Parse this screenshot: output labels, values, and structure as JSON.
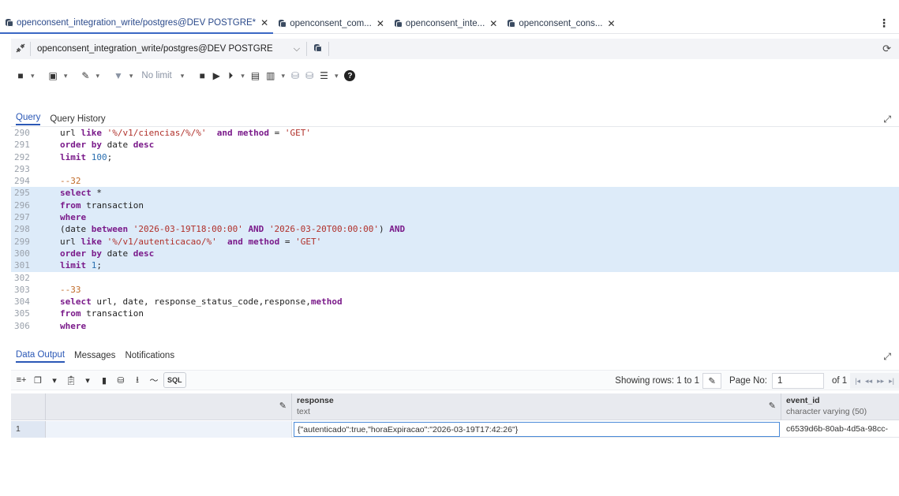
{
  "tabs": [
    {
      "label": "openconsent_integration_write/postgres@DEV POSTGRE*"
    },
    {
      "label": "openconsent_com..."
    },
    {
      "label": "openconsent_inte..."
    },
    {
      "label": "openconsent_cons..."
    }
  ],
  "connection": {
    "label": "openconsent_integration_write/postgres@DEV POSTGRE"
  },
  "toolbar": {
    "limit_label": "No limit"
  },
  "query_tabs": [
    "Query",
    "Query History"
  ],
  "editor_lines": [
    {
      "n": "290",
      "selected": false,
      "tokens": [
        [
          "",
          "url "
        ],
        [
          "kw",
          "like"
        ],
        [
          "",
          " "
        ],
        [
          "str",
          "'%/v1/ciencias/%/%'"
        ],
        [
          "",
          "  "
        ],
        [
          "kw",
          "and"
        ],
        [
          "",
          " "
        ],
        [
          "kw",
          "method"
        ],
        [
          "",
          " = "
        ],
        [
          "str",
          "'GET'"
        ]
      ]
    },
    {
      "n": "291",
      "selected": false,
      "tokens": [
        [
          "kw",
          "order by"
        ],
        [
          "",
          " date "
        ],
        [
          "kw",
          "desc"
        ]
      ]
    },
    {
      "n": "292",
      "selected": false,
      "tokens": [
        [
          "kw",
          "limit"
        ],
        [
          "",
          " "
        ],
        [
          "num",
          "100"
        ],
        [
          "",
          ";"
        ]
      ]
    },
    {
      "n": "293",
      "selected": false,
      "tokens": []
    },
    {
      "n": "294",
      "selected": false,
      "tokens": [
        [
          "cmt",
          "--32"
        ]
      ]
    },
    {
      "n": "295",
      "selected": true,
      "tokens": [
        [
          "kw",
          "select"
        ],
        [
          "",
          " *"
        ]
      ]
    },
    {
      "n": "296",
      "selected": true,
      "tokens": [
        [
          "kw",
          "from"
        ],
        [
          "",
          " transaction"
        ]
      ]
    },
    {
      "n": "297",
      "selected": true,
      "tokens": [
        [
          "kw",
          "where"
        ]
      ]
    },
    {
      "n": "298",
      "selected": true,
      "tokens": [
        [
          "",
          "(date "
        ],
        [
          "kw",
          "between"
        ],
        [
          "",
          " "
        ],
        [
          "str",
          "'2026-03-19T18:00:00'"
        ],
        [
          "",
          " "
        ],
        [
          "kw",
          "AND"
        ],
        [
          "",
          " "
        ],
        [
          "str",
          "'2026-03-20T00:00:00'"
        ],
        [
          "",
          ") "
        ],
        [
          "kw",
          "AND"
        ]
      ]
    },
    {
      "n": "299",
      "selected": true,
      "tokens": [
        [
          "",
          "url "
        ],
        [
          "kw",
          "like"
        ],
        [
          "",
          " "
        ],
        [
          "str",
          "'%/v1/autenticacao/%'"
        ],
        [
          "",
          "  "
        ],
        [
          "kw",
          "and"
        ],
        [
          "",
          " "
        ],
        [
          "kw",
          "method"
        ],
        [
          "",
          " = "
        ],
        [
          "str",
          "'GET'"
        ]
      ]
    },
    {
      "n": "300",
      "selected": true,
      "tokens": [
        [
          "kw",
          "order by"
        ],
        [
          "",
          " date "
        ],
        [
          "kw",
          "desc"
        ]
      ]
    },
    {
      "n": "301",
      "selected": true,
      "tokens": [
        [
          "kw",
          "limit"
        ],
        [
          "",
          " "
        ],
        [
          "num",
          "1"
        ],
        [
          "",
          ";"
        ]
      ]
    },
    {
      "n": "302",
      "selected": false,
      "tokens": []
    },
    {
      "n": "303",
      "selected": false,
      "tokens": [
        [
          "cmt",
          "--33"
        ]
      ]
    },
    {
      "n": "304",
      "selected": false,
      "tokens": [
        [
          "kw",
          "select"
        ],
        [
          "",
          " url, date, response_status_code,response,"
        ],
        [
          "kw",
          "method"
        ]
      ]
    },
    {
      "n": "305",
      "selected": false,
      "tokens": [
        [
          "kw",
          "from"
        ],
        [
          "",
          " transaction"
        ]
      ]
    },
    {
      "n": "306",
      "selected": false,
      "tokens": [
        [
          "kw",
          "where"
        ]
      ]
    }
  ],
  "output_tabs": [
    "Data Output",
    "Messages",
    "Notifications"
  ],
  "results_toolbar": {
    "sql_label": "SQL",
    "rows_info": "Showing rows: 1 to 1",
    "page_label": "Page No:",
    "page_value": "1",
    "page_of": "of 1"
  },
  "grid": {
    "columns": [
      {
        "name": "response",
        "type": "text"
      },
      {
        "name": "event_id",
        "type": "character varying (50)"
      }
    ],
    "rows": [
      {
        "num": "1",
        "response": "{\"autenticado\":true,\"horaExpiracao\":\"2026-03-19T17:42:26\"}",
        "event_id": "c6539d6b-80ab-4d5a-98cc-"
      }
    ]
  },
  "icons": {
    "tab_icon": "database-icon",
    "close": "close-icon",
    "menu": "kebab-menu-icon",
    "connection": "connection-status-icon",
    "refresh": "refresh-icon",
    "edit": "pencil-icon",
    "help": "help-icon",
    "expand": "expand-icon"
  },
  "colors": {
    "accent": "#2b58b6",
    "selection": "#ddebf9",
    "keyword": "#7a1a8a",
    "string": "#b0302a",
    "comment": "#c06a28"
  }
}
